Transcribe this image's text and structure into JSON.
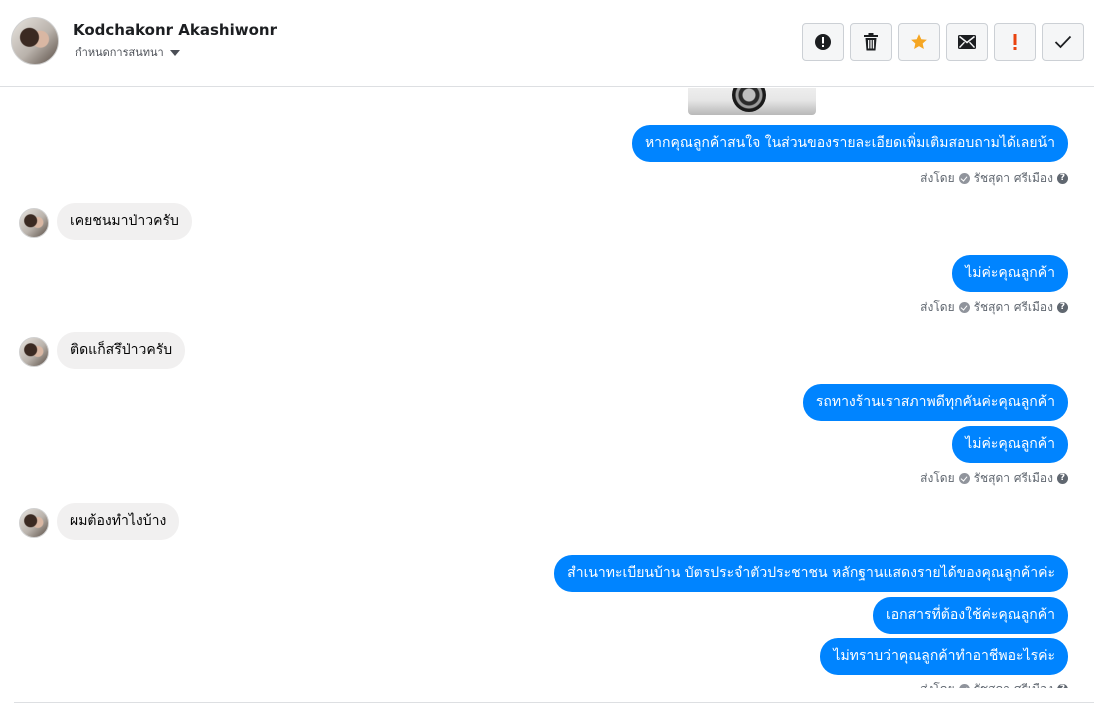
{
  "header": {
    "contact_name": "Kodchakonr Akashiwonr",
    "subtitle": "กำหนดการสนทนา",
    "toolbar": [
      {
        "name": "report-spam-button",
        "icon": "exclamation-circle-icon"
      },
      {
        "name": "delete-button",
        "icon": "trash-icon"
      },
      {
        "name": "star-button",
        "icon": "star-icon"
      },
      {
        "name": "mark-unread-button",
        "icon": "envelope-icon"
      },
      {
        "name": "priority-button",
        "icon": "exclamation-icon"
      },
      {
        "name": "mark-done-button",
        "icon": "check-icon"
      }
    ]
  },
  "colors": {
    "outgoing_bubble": "#0084ff",
    "incoming_bubble": "#f1f0f0",
    "star": "#f5a623",
    "priority": "#e9430f"
  },
  "messages": {
    "m1": "หากคุณลูกค้าสนใจ ในส่วนของรายละเอียดเพิ่มเติมสอบถามได้เลยน้า",
    "m2": "เคยชนมาป่าวครับ",
    "m3": "ไม่ค่ะคุณลูกค้า",
    "m4": "ติดแก็สรึป่าวครับ",
    "m5": "รถทางร้านเราสภาพดีทุกคันค่ะคุณลูกค้า",
    "m6": "ไม่ค่ะคุณลูกค้า",
    "m7": "ผมต้องทำไงบ้าง",
    "m8": "สำเนาทะเบียนบ้าน บัตรประจำตัวประชาชน หลักฐานแสดงรายได้ของคุณลูกค้าค่ะ",
    "m9": "เอกสารที่ต้องใช้ค่ะคุณลูกค้า",
    "m10": "ไม่ทราบว่าคุณลูกค้าทำอาชีพอะไรค่ะ"
  },
  "sent_by": {
    "label": "ส่งโดย",
    "agent": "รัชสุดา ศรีเมือง"
  }
}
